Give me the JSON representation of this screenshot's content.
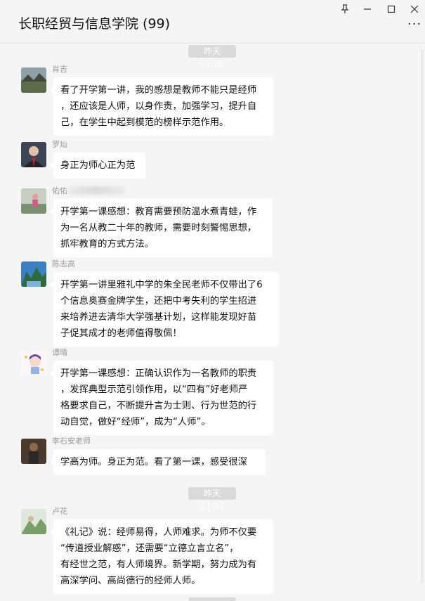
{
  "window": {
    "title": "长职经贸与信息学院 (99)",
    "pin_icon": "pin-icon",
    "minimize_icon": "minimize-icon",
    "maximize_icon": "maximize-icon",
    "close_icon": "close-icon",
    "more_icon": "more-icon"
  },
  "chat": {
    "timestamps": [
      "昨天 21:20",
      "昨天 21:47"
    ],
    "messages": [
      {
        "name": "肖吉",
        "lines": [
          "看了开学第一讲，我的感想是教师不能只是经师",
          "，还应该是人师，以身作责，加强学习，提升自",
          "己，在学生中起到模范的榜样示范作用。"
        ]
      },
      {
        "name": "罗灿",
        "lines": [
          "身正为师心正为范"
        ]
      },
      {
        "name": "佑佑",
        "lines": [
          "开学第一课感想：教育需要预防温水煮青蛙，作",
          "为一名从教二十年的教师，需要时刻警惕思想，",
          "抓牢教育的方式方法。"
        ]
      },
      {
        "name": "陈志高",
        "lines": [
          "开学第一讲里雅礼中学的朱全民老师不仅带出了6",
          "个信息奥赛金牌学生，还把中考失利的学生招进",
          "来培养进去清华大学强基计划，这样能发现好苗",
          "子促其成才的老师值得敬佩！"
        ]
      },
      {
        "name": "谭晴",
        "lines": [
          "开学第一课感想：正确认识作为一名教师的职责",
          "，发挥典型示范引领作用，以“四有”好老师严",
          "格要求自己，不断提升言为士则、行为世范的行",
          "动自觉，做好“经师”，成为“人师”。"
        ]
      },
      {
        "name": "李石安老师",
        "lines": [
          "学高为师。身正为范。看了第一课，感受很深"
        ]
      },
      {
        "name": "卢花",
        "lines": [
          "《礼记》说：经师易得，人师难求。为师不仅要",
          "“传道授业解惑”，还需要“立德立言立名”，",
          "有经世之范，有人师境界。新学期，努力成为有",
          "高深学问、高尚德行的经师人师。"
        ]
      }
    ]
  },
  "colors": {
    "background": "#f5f5f5",
    "bubble": "#ffffff",
    "timestamp_bg": "#dadada",
    "name_text": "#999999"
  }
}
